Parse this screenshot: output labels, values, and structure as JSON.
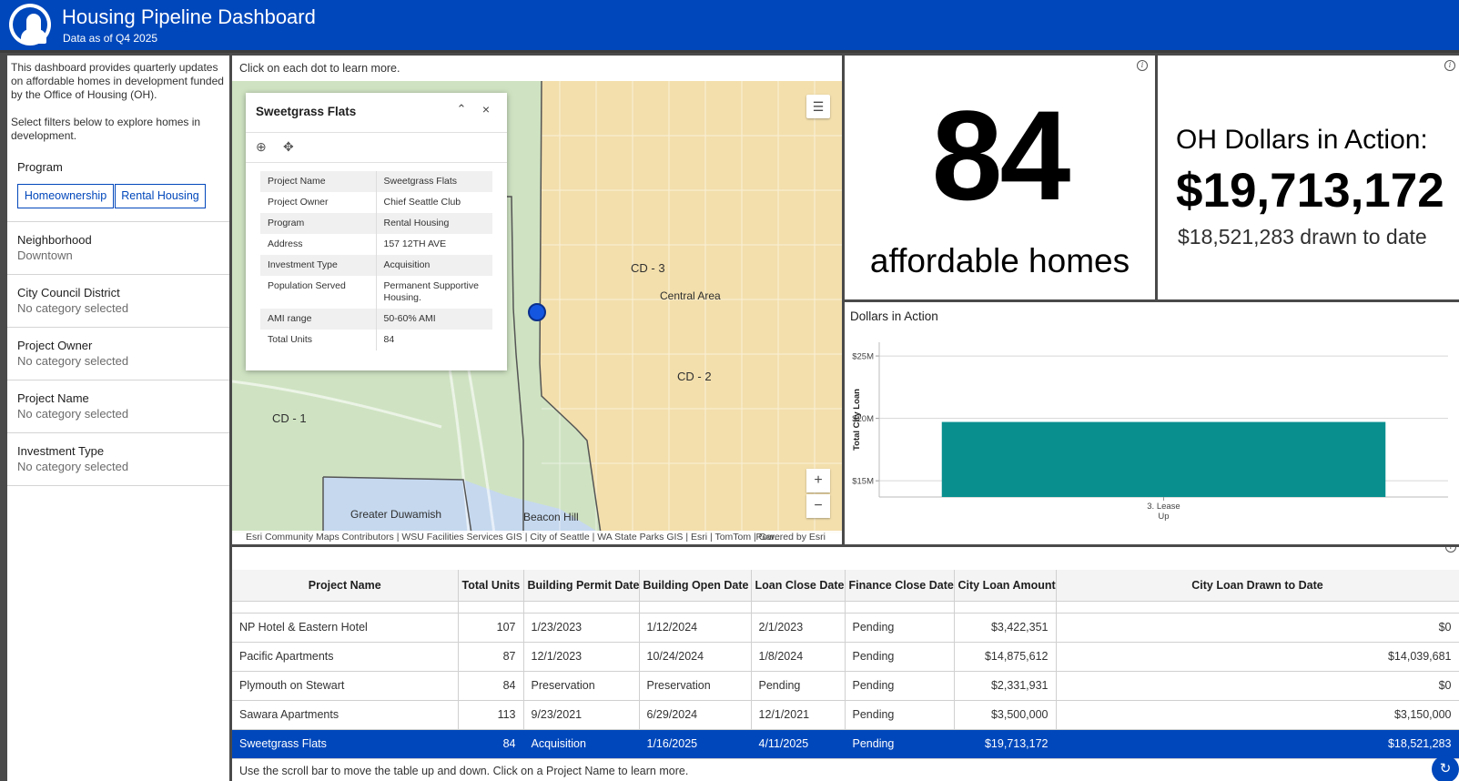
{
  "header": {
    "title": "Housing Pipeline Dashboard",
    "subtitle": "Data as of Q4 2025"
  },
  "sidebar": {
    "intro_1": "This dashboard provides quarterly updates on affordable homes in development funded by the Office of Housing (OH).",
    "intro_2": "Select filters below to explore homes in development.",
    "program": {
      "title": "Program",
      "options": [
        "Homeownership",
        "Rental Housing"
      ]
    },
    "filters": [
      {
        "title": "Neighborhood",
        "value": "Downtown"
      },
      {
        "title": "City Council District",
        "value": "No category selected"
      },
      {
        "title": "Project Owner",
        "value": "No category selected"
      },
      {
        "title": "Project Name",
        "value": "No category selected"
      },
      {
        "title": "Investment Type",
        "value": "No category selected"
      }
    ]
  },
  "map": {
    "hint": "Click on each dot to learn more.",
    "labels": {
      "cd3": "CD - 3",
      "cd2": "CD - 2",
      "cd1": "CD - 1",
      "central_area": "Central Area",
      "greater_duwamish": "Greater Duwamish",
      "beacon_hill": "Beacon Hill"
    },
    "attribution": "Esri Community Maps Contributors | WSU Facilities Services GIS | City of Seattle | WA State Parks GIS | Esri | TomTom | Gar...",
    "powered_by": "Powered by Esri",
    "zoom_in": "+",
    "zoom_out": "−",
    "colors": {
      "district_3": "#f3dfac",
      "district_2": "#cfe3c2",
      "district_1": "#c5d8ee",
      "marker": "#1456e0"
    }
  },
  "popup": {
    "title": "Sweetgrass Flats",
    "collapse": "⌃",
    "close": "×",
    "fields": [
      {
        "key": "Project Name",
        "value": "Sweetgrass Flats"
      },
      {
        "key": "Project Owner",
        "value": "Chief Seattle Club"
      },
      {
        "key": "Program",
        "value": "Rental Housing"
      },
      {
        "key": "Address",
        "value": "157 12TH AVE"
      },
      {
        "key": "Investment Type",
        "value": "Acquisition"
      },
      {
        "key": "Population Served",
        "value": "Permanent Supportive Housing."
      },
      {
        "key": "AMI range",
        "value": "50-60% AMI"
      },
      {
        "key": "Total Units",
        "value": "84"
      }
    ]
  },
  "indicators": {
    "homes_number": "84",
    "homes_label": "affordable homes",
    "dollars_heading": "OH Dollars in Action:",
    "dollars_total": "$19,713,172",
    "dollars_drawn": "$18,521,283 drawn to date"
  },
  "chart_data": {
    "type": "bar",
    "title": "Dollars in Action",
    "ylabel": "Total City Loan",
    "categories": [
      "3. Lease Up"
    ],
    "category_lines": [
      [
        "3. Lease",
        "Up"
      ]
    ],
    "values": [
      19713172
    ],
    "ylim": [
      13700000,
      26100000
    ],
    "yticks": [
      15000000,
      20000000,
      25000000
    ],
    "ytick_labels": [
      "$15M",
      "$20M",
      "$25M"
    ],
    "grid": true,
    "color": "#0a8f8f"
  },
  "table": {
    "columns": [
      "Project Name",
      "Total Units",
      "Building Permit Date",
      "Building Open Date",
      "Loan Close Date",
      "Finance Close Date",
      "City Loan Amount",
      "City Loan Drawn to Date"
    ],
    "rows": [
      [
        "NP Hotel & Eastern Hotel",
        "107",
        "1/23/2023",
        "1/12/2024",
        "2/1/2023",
        "Pending",
        "$3,422,351",
        "$0"
      ],
      [
        "Pacific Apartments",
        "87",
        "12/1/2023",
        "10/24/2024",
        "1/8/2024",
        "Pending",
        "$14,875,612",
        "$14,039,681"
      ],
      [
        "Plymouth on Stewart",
        "84",
        "Preservation",
        "Preservation",
        "Pending",
        "Pending",
        "$2,331,931",
        "$0"
      ],
      [
        "Sawara Apartments",
        "113",
        "9/23/2021",
        "6/29/2024",
        "12/1/2021",
        "Pending",
        "$3,500,000",
        "$3,150,000"
      ],
      [
        "Sweetgrass Flats",
        "84",
        "Acquisition",
        "1/16/2025",
        "4/11/2025",
        "Pending",
        "$19,713,172",
        "$18,521,283"
      ]
    ],
    "selected_row": 4,
    "footer": "Use the scroll bar to move the table up and down. Click on a Project Name to learn more."
  },
  "icons": {
    "info": "i",
    "legend": "☰",
    "popup_zoom": "⊕",
    "popup_pan": "✥",
    "refresh": "↻"
  }
}
